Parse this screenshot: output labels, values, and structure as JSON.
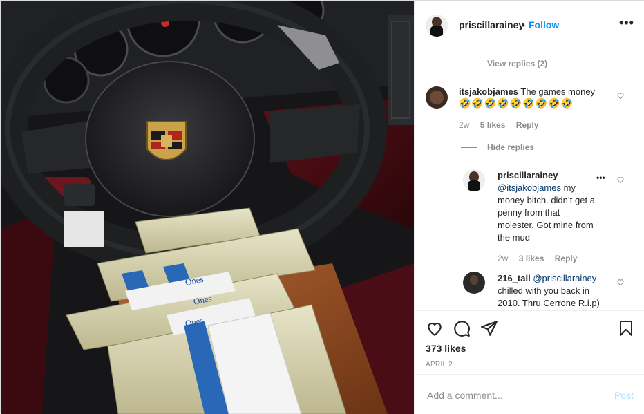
{
  "header": {
    "username": "priscillarainey",
    "separator": "•",
    "follow_label": "Follow",
    "more_label": "•••"
  },
  "comments": {
    "view_replies_label": "View replies (2)",
    "items": [
      {
        "username": "itsjakobjames",
        "text": "The games money",
        "emojis": "🤣🤣🤣🤣🤣🤣🤣🤣🤣",
        "time": "2w",
        "likes": "5 likes",
        "reply_label": "Reply"
      }
    ],
    "hide_replies_label": "Hide replies",
    "replies": [
      {
        "username": "priscillarainey",
        "mention": "@itsjakobjames",
        "line1_rest": " my",
        "line2": "money bitch. didn’t get a",
        "line3": "penny from that",
        "line4": "molester. Got mine from",
        "line5": "the mud",
        "time": "2w",
        "likes": "3 likes",
        "reply_label": "Reply",
        "more_label": "•••"
      },
      {
        "username": "216_tall",
        "mention": "@priscillarainey",
        "line2": "chilled with you back in",
        "line3": "2010. Thru Cerrone R.i.p)"
      }
    ]
  },
  "actions": {
    "like_icon": "heart-icon",
    "comment_icon": "comment-icon",
    "share_icon": "paper-plane-icon",
    "save_icon": "bookmark-icon",
    "likes_count": "373 likes",
    "date": "APRIL 2"
  },
  "add_comment": {
    "placeholder": "Add a comment...",
    "post_label": "Post"
  },
  "photo": {
    "band_label": "Ones",
    "badge_text": "PORSCHE"
  },
  "colors": {
    "link_blue": "#0095f6",
    "mention_blue": "#00376b",
    "muted_gray": "#8e8e8e",
    "post_disabled": "#b2dffc"
  }
}
